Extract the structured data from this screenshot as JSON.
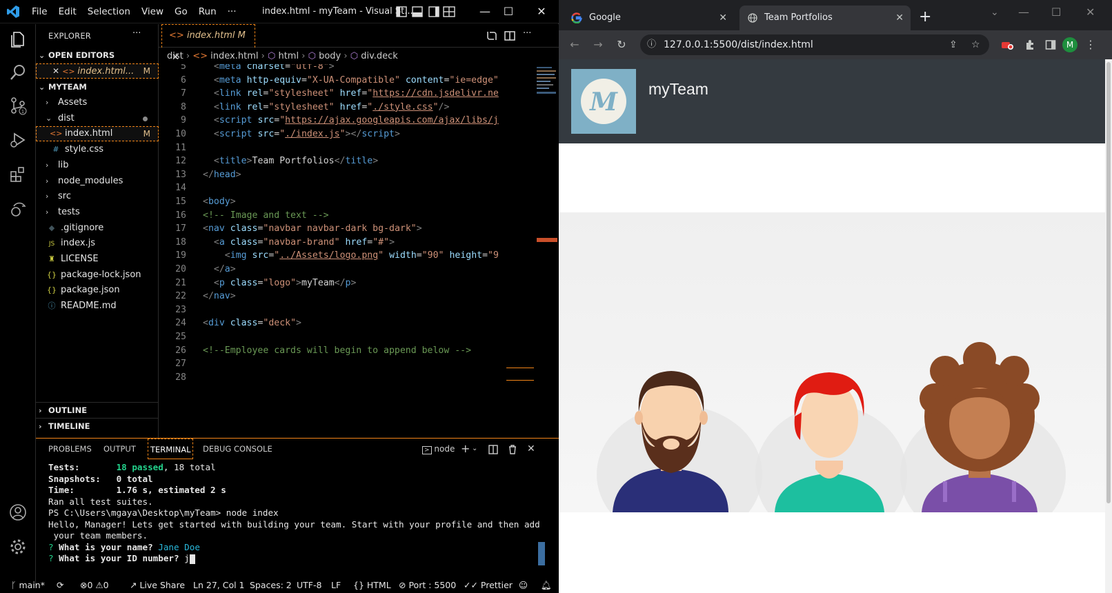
{
  "vscode": {
    "menus": [
      "File",
      "Edit",
      "Selection",
      "View",
      "Go",
      "Run",
      "···"
    ],
    "window_title": "index.html - myTeam - Visual St...",
    "explorer": {
      "header": "EXPLORER",
      "more": "···",
      "open_editors_label": "OPEN EDITORS",
      "open_editor_file": "index.html...",
      "open_editor_badge": "M",
      "project_label": "MYTEAM",
      "items": [
        {
          "label": "Assets",
          "type": "folder",
          "depth": 1,
          "badge": ""
        },
        {
          "label": "dist",
          "type": "folder-open",
          "depth": 1,
          "badge": ""
        },
        {
          "label": "index.html",
          "type": "html",
          "depth": 2,
          "badge": "M"
        },
        {
          "label": "style.css",
          "type": "css",
          "depth": 2,
          "badge": ""
        },
        {
          "label": "lib",
          "type": "folder",
          "depth": 1,
          "badge": ""
        },
        {
          "label": "node_modules",
          "type": "folder",
          "depth": 1,
          "badge": ""
        },
        {
          "label": "src",
          "type": "folder",
          "depth": 1,
          "badge": ""
        },
        {
          "label": "tests",
          "type": "folder",
          "depth": 1,
          "badge": ""
        },
        {
          "label": ".gitignore",
          "type": "git",
          "depth": 1,
          "badge": ""
        },
        {
          "label": "index.js",
          "type": "js",
          "depth": 1,
          "badge": ""
        },
        {
          "label": "LICENSE",
          "type": "license",
          "depth": 1,
          "badge": ""
        },
        {
          "label": "package-lock.json",
          "type": "json",
          "depth": 1,
          "badge": ""
        },
        {
          "label": "package.json",
          "type": "json",
          "depth": 1,
          "badge": ""
        },
        {
          "label": "README.md",
          "type": "info",
          "depth": 1,
          "badge": ""
        }
      ],
      "outline_label": "OUTLINE",
      "timeline_label": "TIMELINE"
    },
    "tab": {
      "label": "index.html",
      "badge": "M"
    },
    "breadcrumb": [
      "dist",
      "index.html",
      "html",
      "body",
      "div.deck"
    ],
    "code_lines": [
      {
        "n": "5",
        "html": "<span class='tg'>  &lt;</span><span class='tn'>meta</span> <span class='at'>charset</span>=<span class='st'>\"utf-8\"</span><span class='tg'>&gt;</span>"
      },
      {
        "n": "6",
        "html": "  <span class='tg'>&lt;</span><span class='tn'>meta</span> <span class='at'>http-equiv</span>=<span class='st'>\"X-UA-Compatible\"</span> <span class='at'>content</span>=<span class='st'>\"ie=edge\"</span>"
      },
      {
        "n": "7",
        "html": "  <span class='tg'>&lt;</span><span class='tn'>link</span> <span class='at'>rel</span>=<span class='st'>\"stylesheet\"</span> <span class='at'>href</span>=<span class='st'>\"<span class='u'>https://cdn.jsdelivr.ne</span></span>"
      },
      {
        "n": "8",
        "html": "  <span class='tg'>&lt;</span><span class='tn'>link</span> <span class='at'>rel</span>=<span class='st'>\"stylesheet\"</span> <span class='at'>href</span>=<span class='st'>\"<span class='u'>./style.css</span>\"</span><span class='tg'>/&gt;</span>"
      },
      {
        "n": "9",
        "html": "  <span class='tg'>&lt;</span><span class='tn'>script</span> <span class='at'>src</span>=<span class='st'>\"<span class='u'>https://ajax.googleapis.com/ajax/libs/j</span></span>"
      },
      {
        "n": "10",
        "html": "  <span class='tg'>&lt;</span><span class='tn'>script</span> <span class='at'>src</span>=<span class='st'>\"<span class='u'>./index.js</span>\"</span><span class='tg'>&gt;&lt;/</span><span class='tn'>script</span><span class='tg'>&gt;</span>"
      },
      {
        "n": "11",
        "html": ""
      },
      {
        "n": "12",
        "html": "  <span class='tg'>&lt;</span><span class='tn'>title</span><span class='tg'>&gt;</span><span class='tx'>Team Portfolios</span><span class='tg'>&lt;/</span><span class='tn'>title</span><span class='tg'>&gt;</span>"
      },
      {
        "n": "13",
        "html": "<span class='tg'>&lt;/</span><span class='tn'>head</span><span class='tg'>&gt;</span>"
      },
      {
        "n": "14",
        "html": ""
      },
      {
        "n": "15",
        "html": "<span class='tg'>&lt;</span><span class='tn'>body</span><span class='tg'>&gt;</span>"
      },
      {
        "n": "16",
        "html": "<span class='cm'>&lt;!-- Image and text --&gt;</span>"
      },
      {
        "n": "17",
        "html": "<span class='tg'>&lt;</span><span class='tn'>nav</span> <span class='at'>class</span>=<span class='st'>\"navbar navbar-dark bg-dark\"</span><span class='tg'>&gt;</span>"
      },
      {
        "n": "18",
        "html": "  <span class='tg'>&lt;</span><span class='tn'>a</span> <span class='at'>class</span>=<span class='st'>\"navbar-brand\"</span> <span class='at'>href</span>=<span class='st'>\"#\"</span><span class='tg'>&gt;</span>"
      },
      {
        "n": "19",
        "html": "    <span class='tg'>&lt;</span><span class='tn'>img</span> <span class='at'>src</span>=<span class='st'>\"<span class='u'>../Assets/logo.png</span>\"</span> <span class='at'>width</span>=<span class='st'>\"90\"</span> <span class='at'>height</span>=<span class='st'>\"9</span>"
      },
      {
        "n": "20",
        "html": "  <span class='tg'>&lt;/</span><span class='tn'>a</span><span class='tg'>&gt;</span>"
      },
      {
        "n": "21",
        "html": "  <span class='tg'>&lt;</span><span class='tn'>p</span> <span class='at'>class</span>=<span class='st'>\"logo\"</span><span class='tg'>&gt;</span><span class='tx'>myTeam</span><span class='tg'>&lt;/</span><span class='tn'>p</span><span class='tg'>&gt;</span>"
      },
      {
        "n": "22",
        "html": "<span class='tg'>&lt;/</span><span class='tn'>nav</span><span class='tg'>&gt;</span>"
      },
      {
        "n": "23",
        "html": ""
      },
      {
        "n": "24",
        "html": "<span class='tg'>&lt;</span><span class='tn'>div</span> <span class='at'>class</span>=<span class='st'>\"deck\"</span><span class='tg'>&gt;</span>"
      },
      {
        "n": "25",
        "html": ""
      },
      {
        "n": "26",
        "html": "<span class='cm'>&lt;!--Employee cards will begin to append below --&gt;</span>"
      },
      {
        "n": "27",
        "html": ""
      },
      {
        "n": "28",
        "html": ""
      }
    ],
    "panel_tabs": [
      "PROBLEMS",
      "OUTPUT",
      "TERMINAL",
      "DEBUG CONSOLE"
    ],
    "terminal_shell": "node",
    "terminal": {
      "tests_label": "Tests:",
      "tests_passed": "18 passed",
      "tests_total": ", 18 total",
      "snapshots": "Snapshots:   0 total",
      "time": "Time:        1.76 s, estimated 2 s",
      "ran": "Ran all test suites.",
      "prompt": "PS C:\\Users\\mgaya\\Desktop\\myTeam> node index",
      "hello1": "Hello, Manager! Lets get started with building your team. Start with your profile and then add",
      "hello2": " your team members.",
      "q1": "What is your name?",
      "a1": "Jane Doe",
      "q2": "What is your ID number?",
      "a2": "j"
    },
    "status": {
      "branch": "main*",
      "errors": "0",
      "warnings": "0",
      "live_share": "Live Share",
      "position": "Ln 27, Col 1",
      "spaces": "Spaces: 2",
      "encoding": "UTF-8",
      "eol": "LF",
      "language": "HTML",
      "port": "Port : 5500",
      "prettier": "Prettier"
    }
  },
  "chrome": {
    "tabs": [
      {
        "label": "Google",
        "active": false
      },
      {
        "label": "Team Portfolios",
        "active": true
      }
    ],
    "url": "127.0.0.1:5500/dist/index.html",
    "profile_initial": "M",
    "page": {
      "logo_letter": "M",
      "brand": "myTeam"
    }
  }
}
